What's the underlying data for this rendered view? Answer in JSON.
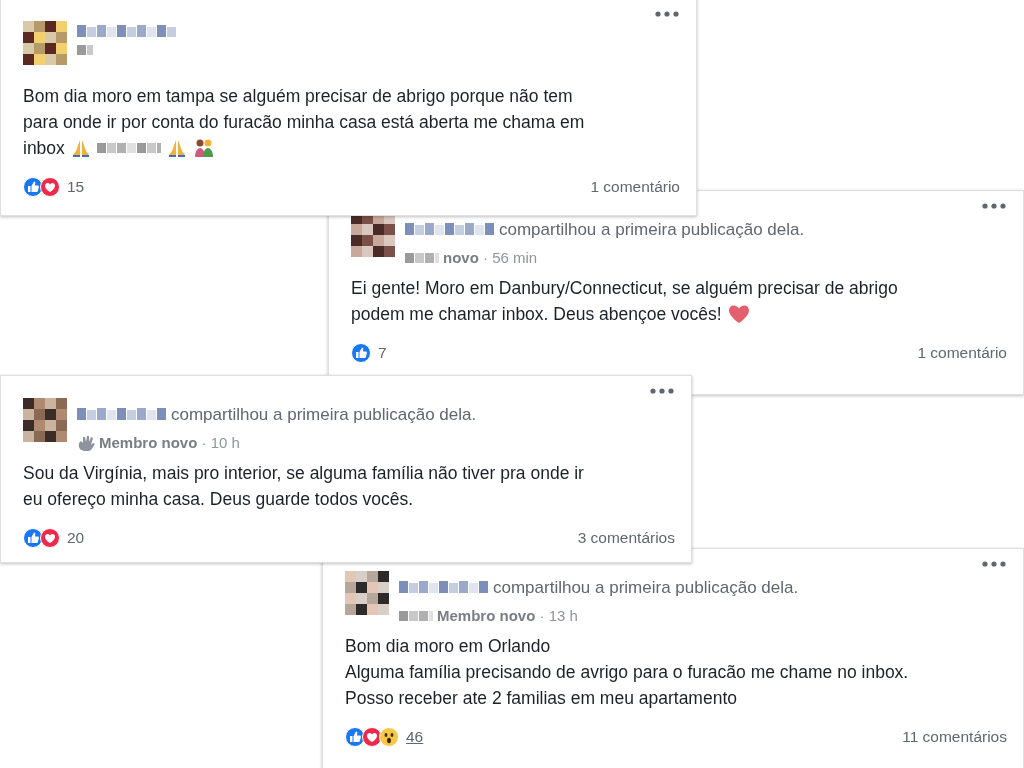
{
  "posts": [
    {
      "meta_icon": {
        "kind": "blur"
      },
      "body_lines": [
        "Bom dia moro em tampa se alguém precisar de abrigo porque não tem",
        "para onde ir por conta do furacão minha casa está aberta me chama em",
        "inbox"
      ],
      "line_end": [
        {
          "kind": "pray"
        },
        {
          "kind": "blur"
        },
        {
          "kind": "pray"
        },
        {
          "kind": "family"
        }
      ],
      "reactions": [
        {
          "kind": "like"
        },
        {
          "kind": "love"
        }
      ],
      "reaction_count": "15",
      "count_underlined": false,
      "comments": "1 comentário"
    },
    {
      "shared_text": "compartilhou a primeira publicação dela.",
      "meta_icon": {
        "kind": "blur"
      },
      "meta": "**novo** · 56 min",
      "body_lines": [
        "Ei gente! Moro em Danbury/Connecticut, se alguém precisar de abrigo",
        "podem me chamar inbox. Deus abençoe vocês!"
      ],
      "line_end": [
        {
          "kind": "heart"
        }
      ],
      "reactions": [
        {
          "kind": "like"
        }
      ],
      "reaction_count": "7",
      "count_underlined": false,
      "comments": "1 comentário"
    },
    {
      "shared_text": "compartilhou a primeira publicação dela.",
      "meta_icon": {
        "kind": "wave"
      },
      "meta": "**Membro novo** · 10 h",
      "body_lines": [
        "Sou da Virgínia, mais pro interior, se alguma família não tiver pra onde ir",
        "eu ofereço minha casa. Deus guarde todos vocês."
      ],
      "reactions": [
        {
          "kind": "like"
        },
        {
          "kind": "love"
        }
      ],
      "reaction_count": "20",
      "count_underlined": false,
      "comments": "3 comentários"
    },
    {
      "shared_text": "compartilhou a primeira publicação dela.",
      "meta_icon": {
        "kind": "blur"
      },
      "meta": "**Membro novo** · 13 h",
      "body_lines": [
        "Bom dia moro em Orlando",
        "Alguma família precisando de avrigo para o furacão me chame no inbox.",
        "Posso receber ate 2 familias em meu apartamento"
      ],
      "reactions": [
        {
          "kind": "like"
        },
        {
          "kind": "love"
        },
        {
          "kind": "wow"
        }
      ],
      "reaction_count": "46",
      "count_underlined": true,
      "comments": "11 comentários"
    }
  ]
}
